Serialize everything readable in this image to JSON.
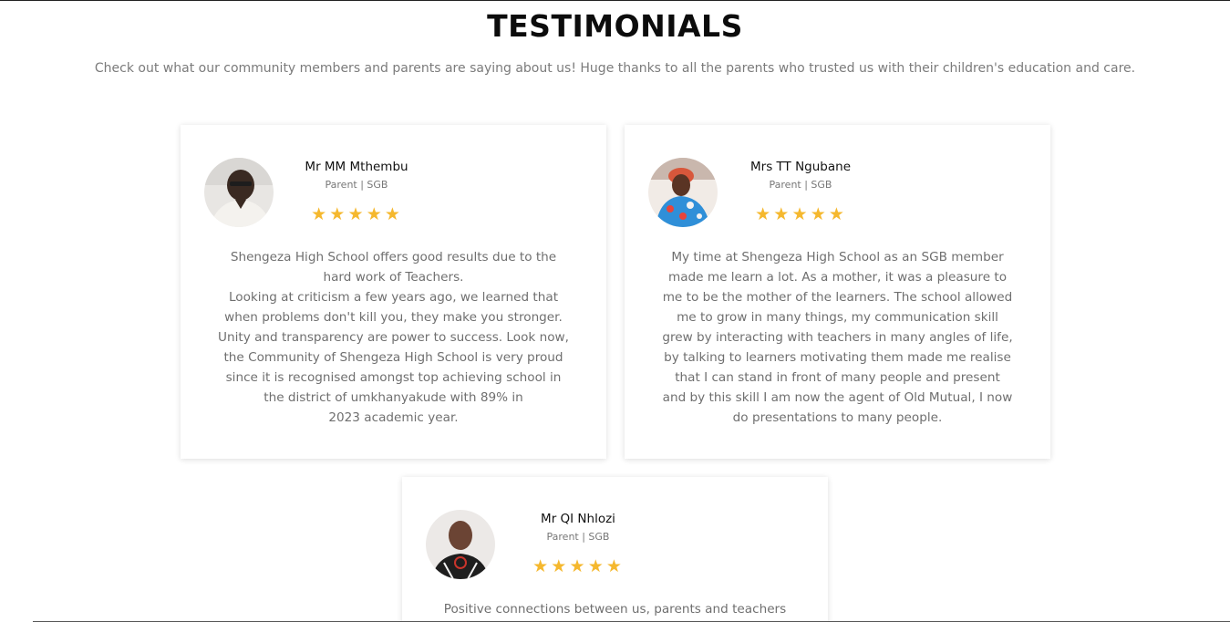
{
  "section": {
    "title": "TESTIMONIALS",
    "subtitle": "Check out what our community members and parents are saying about us! Huge thanks to all the parents who trusted us with their children's education and care."
  },
  "colors": {
    "star": "#f5b82e",
    "title": "#0c0c0c",
    "body_text": "#6f6f6f"
  },
  "testimonials": [
    {
      "name": "Mr MM Mthembu",
      "role": "Parent | SGB",
      "rating": 5,
      "avatar": "person-photo",
      "quote_lines": [
        "Shengeza High School offers good results due to the",
        "hard work of Teachers.",
        "Looking at criticism a few years ago, we learned that",
        "when problems don't kill you, they make you stronger.",
        "Unity and transparency are power to success. Look now,",
        "the Community of Shengeza High School is very proud",
        "since it is recognised amongst top achieving school in",
        "the district of umkhanyakude with 89% in",
        "2023 academic year."
      ]
    },
    {
      "name": "Mrs TT Ngubane",
      "role": "Parent | SGB",
      "rating": 5,
      "avatar": "person-photo",
      "quote_lines": [
        "My time at Shengeza High School as an SGB member",
        "made me learn a lot. As a mother, it was a pleasure to",
        "me to be the mother of the learners. The school allowed",
        "me to grow in many things, my communication skill",
        "grew by interacting with teachers in many angles of life,",
        "by talking to learners motivating them made me realise",
        "that I can stand in front of many people and present",
        "and by this skill I am now the agent of Old Mutual, I now",
        "do presentations to many people."
      ]
    },
    {
      "name": "Mr QI Nhlozi",
      "role": "Parent | SGB",
      "rating": 5,
      "avatar": "person-photo",
      "quote_lines": [
        "Positive connections between us, parents and teachers"
      ]
    }
  ],
  "star_glyph": "★"
}
